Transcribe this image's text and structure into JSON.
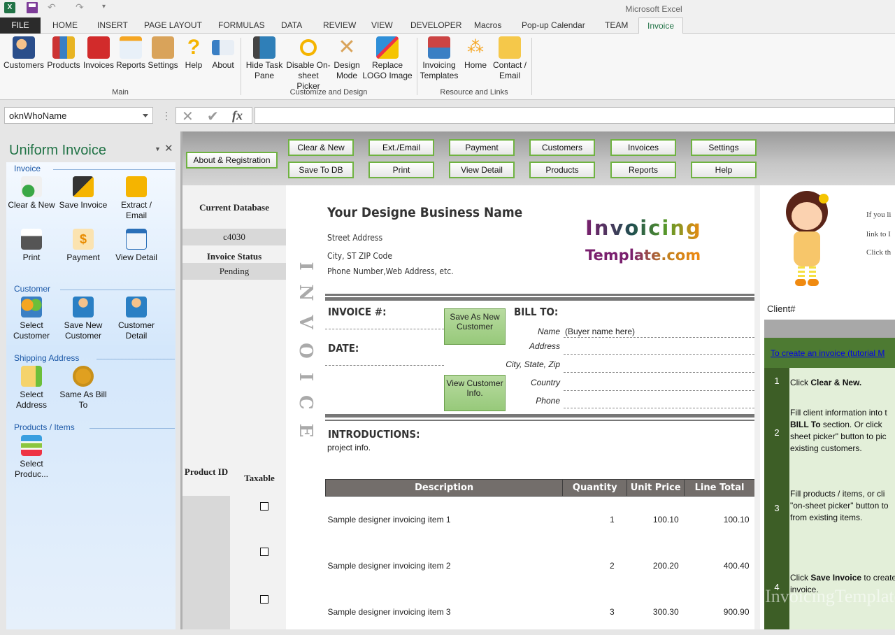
{
  "window": {
    "title": "Microsoft Excel"
  },
  "quick_access": {
    "icons": [
      "excel-logo-icon",
      "save-icon",
      "undo-icon",
      "redo-icon",
      "customize-qat-icon"
    ]
  },
  "tabs": [
    "FILE",
    "HOME",
    "INSERT",
    "PAGE LAYOUT",
    "FORMULAS",
    "DATA",
    "REVIEW",
    "VIEW",
    "DEVELOPER",
    "Macros",
    "Pop-up Calendar",
    "TEAM",
    "Invoice"
  ],
  "active_tab": "Invoice",
  "ribbon": {
    "groups": [
      {
        "label": "Main",
        "buttons": [
          "Customers",
          "Products",
          "Invoices",
          "Reports",
          "Settings",
          "Help",
          "About"
        ]
      },
      {
        "label": "Customize and Design",
        "buttons": [
          "Hide Task Pane",
          "Disable On-sheet Picker",
          "Design Mode",
          "Replace LOGO Image"
        ]
      },
      {
        "label": "Resource and Links",
        "buttons": [
          "Invoicing Templates",
          "Home",
          "Contact / Email"
        ]
      }
    ]
  },
  "formula_bar": {
    "name_box": "oknWhoName",
    "fx": "fx",
    "value": ""
  },
  "task_pane": {
    "title": "Uniform Invoice",
    "sections": [
      {
        "label": "Invoice",
        "buttons": [
          "Clear & New",
          "Save Invoice",
          "Extract / Email",
          "Print",
          "Payment",
          "View Detail"
        ]
      },
      {
        "label": "Customer",
        "buttons": [
          "Select Customer",
          "Save New Customer",
          "Customer Detail"
        ]
      },
      {
        "label": "Shipping Address",
        "buttons": [
          "Select Address",
          "Same As Bill To"
        ]
      },
      {
        "label": "Products / Items",
        "buttons": [
          "Select Produc..."
        ]
      }
    ]
  },
  "sheet_buttons": {
    "about": "About & Registration",
    "row1": [
      "Clear & New",
      "Ext./Email",
      "Payment",
      "Customers",
      "Invoices",
      "Settings"
    ],
    "row2": [
      "Save To DB",
      "Print",
      "View Detail",
      "Products",
      "Reports",
      "Help"
    ]
  },
  "left_panel": {
    "current_db_label": "Current Database",
    "current_db_value": "c4030",
    "status_label": "Invoice Status",
    "status_value": "Pending",
    "product_id_label": "Product ID",
    "taxable_label": "Taxable"
  },
  "invoice": {
    "vertical_title": "INVOICE",
    "business_name": "Your Designe Business Name",
    "street": "Street Address",
    "city": "City, ST  ZIP Code",
    "phone": "Phone Number,Web Address, etc.",
    "logo_line1": "Invoicing",
    "logo_line2": "Template.com",
    "invoice_no_label": "INVOICE #:",
    "date_label": "DATE:",
    "bill_to_label": "BILL TO:",
    "save_new_customer_btn": "Save As New Customer",
    "view_customer_btn": "View Customer Info.",
    "bill_fields": [
      {
        "label": "Name",
        "value": "(Buyer name here)"
      },
      {
        "label": "Address",
        "value": ""
      },
      {
        "label": "City, State, Zip",
        "value": ""
      },
      {
        "label": "Country",
        "value": ""
      },
      {
        "label": "Phone",
        "value": ""
      }
    ],
    "intro_label": "INTRODUCTIONS:",
    "intro_text": "project info.",
    "columns": [
      "Description",
      "Quantity",
      "Unit Price",
      "Line Total"
    ],
    "items": [
      {
        "description": "Sample designer invoicing item 1",
        "quantity": "1",
        "unit_price": "100.10",
        "line_total": "100.10",
        "taxable": false
      },
      {
        "description": "Sample designer invoicing item 2",
        "quantity": "2",
        "unit_price": "200.20",
        "line_total": "400.40",
        "taxable": false
      },
      {
        "description": "Sample designer invoicing item 3",
        "quantity": "3",
        "unit_price": "300.30",
        "line_total": "900.90",
        "taxable": false
      }
    ]
  },
  "right_panel": {
    "promo_lines": [
      "If you li",
      "link to I",
      "Click th"
    ],
    "client_label": "Client#",
    "tutorial_link": "To create an invoice (tutorial M",
    "steps": [
      {
        "n": "1",
        "pre": "Click ",
        "bold": "Clear & New.",
        "post": ""
      },
      {
        "n": "2",
        "pre": "Fill client information into t",
        "bold": "BILL To",
        "post": " section. Or click sheet picker\" button to pic existing customers."
      },
      {
        "n": "3",
        "pre": "Fill products / items, or cli \"on-sheet picker\" button to from existing items.",
        "bold": "",
        "post": ""
      },
      {
        "n": "4",
        "pre": "Click ",
        "bold": "Save Invoice",
        "post": " to create invoice."
      }
    ],
    "watermark": "www.InvoicingTemplate.com"
  },
  "colors": {
    "excel_green": "#217346",
    "button_border": "#6fb341",
    "step_dark": "#3d5e26",
    "step_light": "#e3efd9",
    "header_gray": "#736e6b"
  }
}
